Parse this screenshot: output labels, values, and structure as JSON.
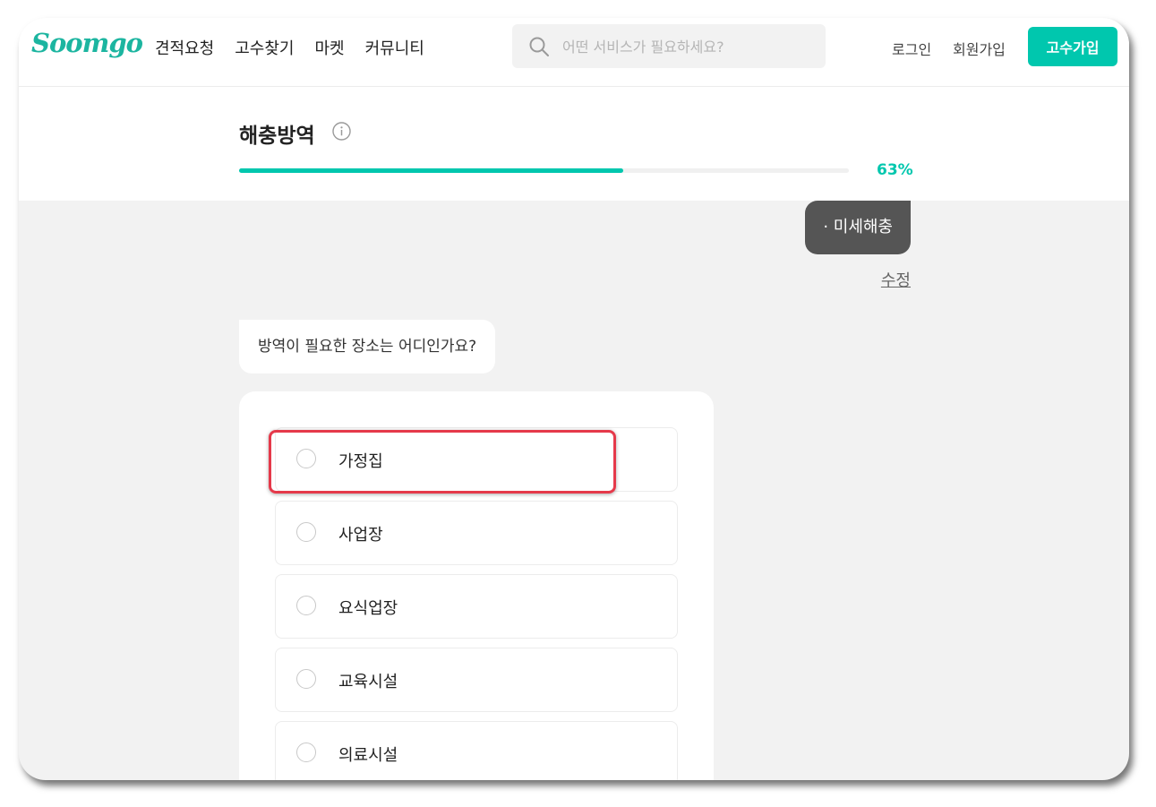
{
  "header": {
    "logo": "Soomgo",
    "nav": [
      "견적요청",
      "고수찾기",
      "마켓",
      "커뮤니티"
    ],
    "search_placeholder": "어떤 서비스가 필요하세요?",
    "login": "로그인",
    "signup": "회원가입",
    "pro_signup": "고수가입"
  },
  "service": {
    "title": "해충방역",
    "progress_percent": 63,
    "progress_text": "63%"
  },
  "chat": {
    "previous_answer": "· 미세해충",
    "edit_label": "수정",
    "question": "방역이 필요한 장소는 어디인가요?"
  },
  "options": [
    "가정집",
    "사업장",
    "요식업장",
    "교육시설",
    "의료시설"
  ],
  "selected_option": "",
  "colors": {
    "brand": "#00c7ae",
    "highlight": "#e5394a",
    "answer_bubble": "#555555"
  }
}
